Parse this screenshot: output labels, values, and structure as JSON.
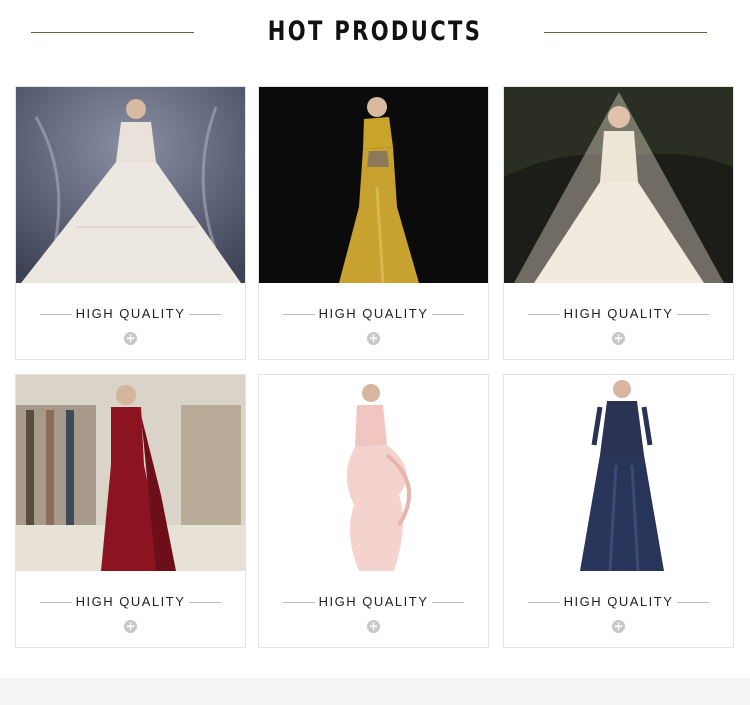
{
  "header": {
    "title": "HOT PRODUCTS"
  },
  "products": [
    {
      "caption": "HIGH QUALITY",
      "image": "white-ballgown-wedding-dress"
    },
    {
      "caption": "HIGH QUALITY",
      "image": "gold-satin-mermaid-gown"
    },
    {
      "caption": "HIGH QUALITY",
      "image": "lace-bridal-gown-with-veil"
    },
    {
      "caption": "HIGH QUALITY",
      "image": "red-satin-mermaid-gown"
    },
    {
      "caption": "HIGH QUALITY",
      "image": "pink-ruffle-gown"
    },
    {
      "caption": "HIGH QUALITY",
      "image": "navy-lace-evening-gown"
    }
  ],
  "icons": {
    "plus": "plus-circle-icon"
  },
  "colors": {
    "accent_line": "#6b5a44",
    "plus_badge": "#c8c8c8",
    "card_border": "#e3e3e3"
  }
}
